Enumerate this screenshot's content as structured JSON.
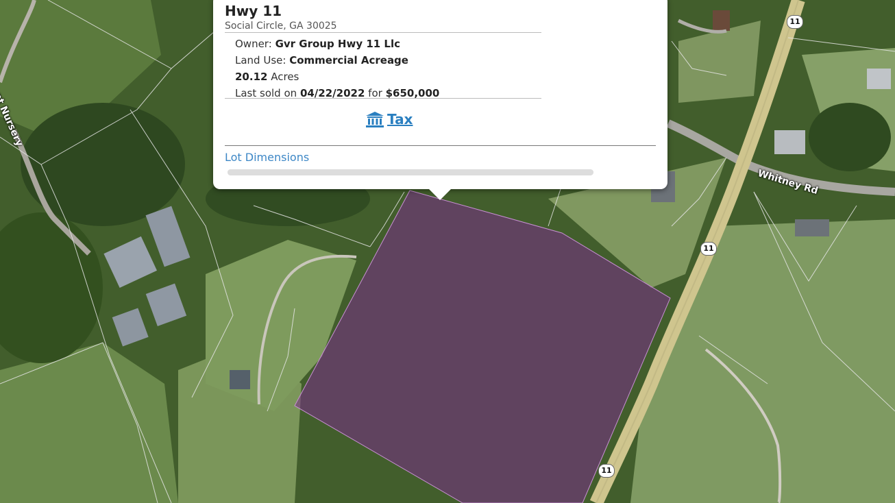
{
  "map": {
    "road_labels": {
      "nursery": "lant Nursery",
      "whitney": "Whitney Rd"
    },
    "highway_shields": [
      "11",
      "11",
      "11"
    ],
    "parcel_color": "#7a2d8a"
  },
  "popup": {
    "title": "Hwy 11",
    "address": "Social Circle, GA 30025",
    "owner_label": "Owner:",
    "owner_value": "Gvr Group Hwy 11 Llc",
    "land_use_label": "Land Use:",
    "land_use_value": "Commercial Acreage",
    "acres_value": "20.12",
    "acres_label": "Acres",
    "sold_prefix": "Last sold on",
    "sold_date": "04/22/2022",
    "sold_mid": "for",
    "sold_price": "$650,000",
    "tax_link": "Tax",
    "tax_icon": "bank-icon",
    "lot_dimensions": "Lot Dimensions",
    "accent_color": "#2a7fc0"
  }
}
